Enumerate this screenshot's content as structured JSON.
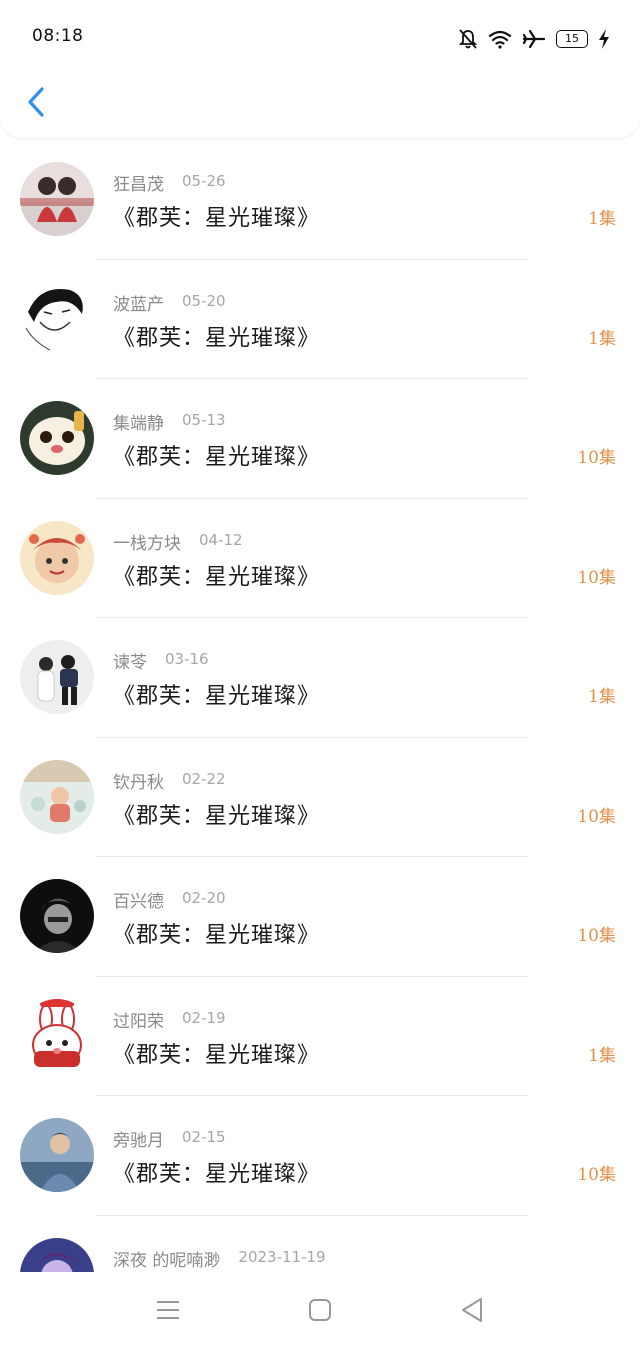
{
  "status_bar": {
    "time": "08:18",
    "battery": "15",
    "icons": [
      "bell-muted-icon",
      "wifi-icon",
      "airplane-icon",
      "battery-icon",
      "charging-bolt-icon"
    ]
  },
  "header": {
    "back_icon": "chevron-left-icon"
  },
  "colors": {
    "accent_blue": "#2f8ff0",
    "count_orange": "#e3914a",
    "name_gray": "#8a8a8a",
    "title_black": "#1a1a1a"
  },
  "items": [
    {
      "name": "狂昌茂",
      "date": "05-26",
      "title": "《郡芙：星光璀璨》",
      "count": "1集"
    },
    {
      "name": "波蓝产",
      "date": "05-20",
      "title": "《郡芙：星光璀璨》",
      "count": "1集"
    },
    {
      "name": "集端静",
      "date": "05-13",
      "title": "《郡芙：星光璀璨》",
      "count": "10集"
    },
    {
      "name": "一栈方块",
      "date": "04-12",
      "title": "《郡芙：星光璀璨》",
      "count": "10集"
    },
    {
      "name": "谏苓",
      "date": "03-16",
      "title": "《郡芙：星光璀璨》",
      "count": "1集"
    },
    {
      "name": "钦丹秋",
      "date": "02-22",
      "title": "《郡芙：星光璀璨》",
      "count": "10集"
    },
    {
      "name": "百兴德",
      "date": "02-20",
      "title": "《郡芙：星光璀璨》",
      "count": "10集"
    },
    {
      "name": "过阳荣",
      "date": "02-19",
      "title": "《郡芙：星光璀璨》",
      "count": "1集"
    },
    {
      "name": "旁驰月",
      "date": "02-15",
      "title": "《郡芙：星光璀璨》",
      "count": "10集"
    },
    {
      "name": "深夜 的呢喃渺",
      "date": "2023-11-19",
      "title": "",
      "count": ""
    }
  ],
  "nav_bar": {
    "icons": [
      "menu-icon",
      "home-square-icon",
      "back-triangle-icon"
    ]
  }
}
